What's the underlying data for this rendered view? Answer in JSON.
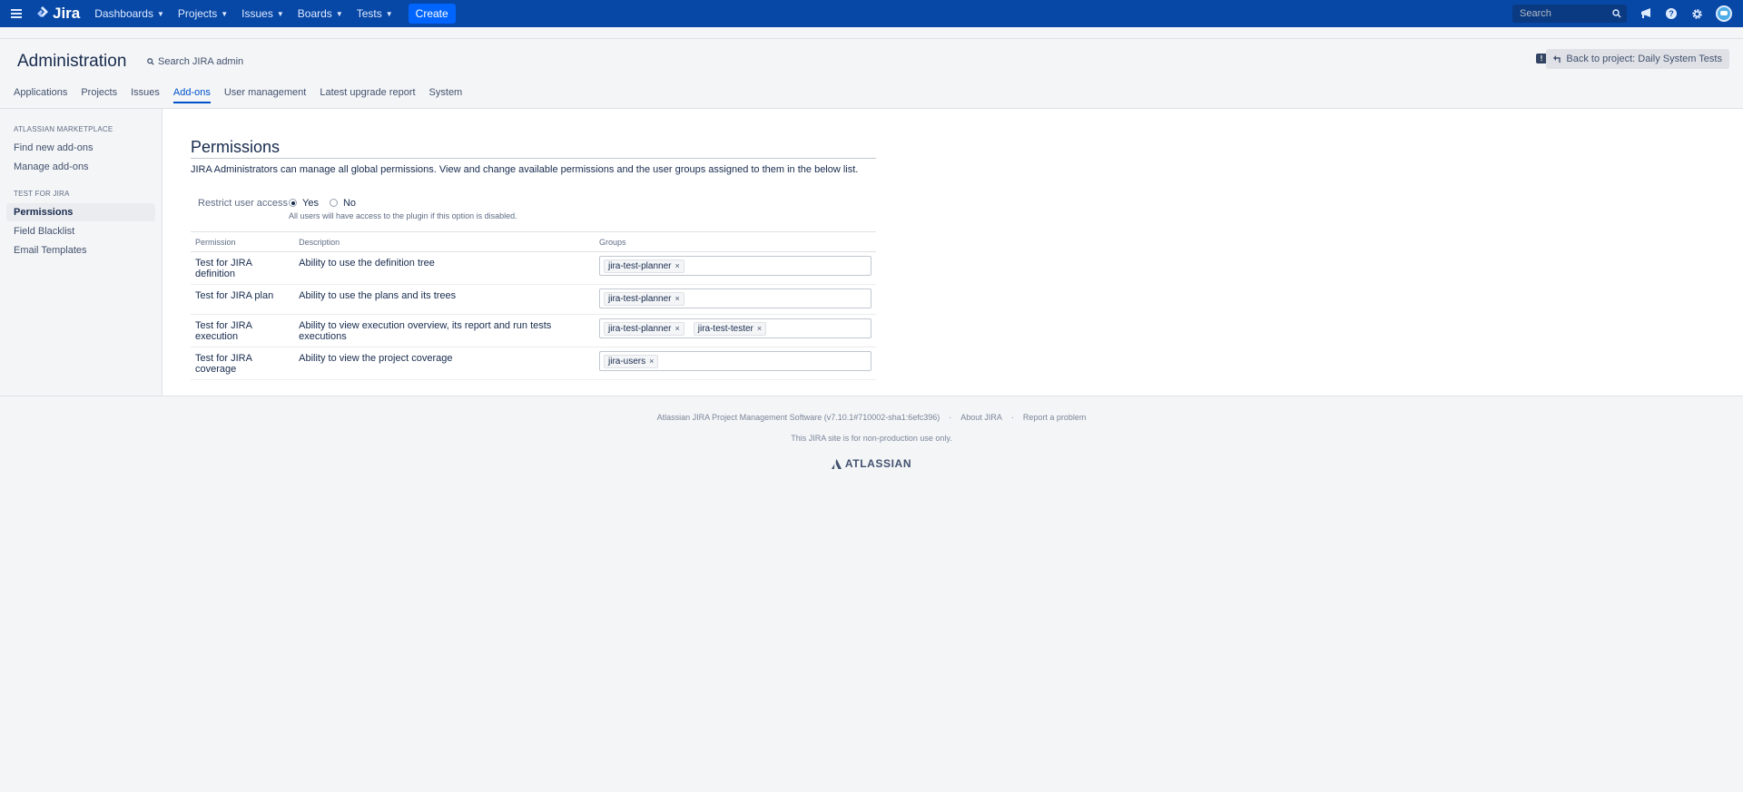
{
  "topnav": {
    "logo_text": "Jira",
    "menus": [
      {
        "label": "Dashboards"
      },
      {
        "label": "Projects"
      },
      {
        "label": "Issues"
      },
      {
        "label": "Boards"
      },
      {
        "label": "Tests"
      }
    ],
    "create_label": "Create",
    "search_placeholder": "Search",
    "icons": [
      "hamburger-icon",
      "jira-logo-icon",
      "search-icon",
      "notifications-icon",
      "help-icon",
      "settings-gear-icon",
      "avatar"
    ],
    "colors": {
      "bar": "#0747a6",
      "create": "#0065ff"
    }
  },
  "admin": {
    "title": "Administration",
    "search_label": "Search JIRA admin",
    "feedback_glyph": "!",
    "back_label": "Back to project: Daily System Tests"
  },
  "tabs": [
    {
      "label": "Applications"
    },
    {
      "label": "Projects"
    },
    {
      "label": "Issues"
    },
    {
      "label": "Add-ons",
      "active": true
    },
    {
      "label": "User management"
    },
    {
      "label": "Latest upgrade report"
    },
    {
      "label": "System"
    }
  ],
  "sidebar": {
    "sections": [
      {
        "heading": "ATLASSIAN MARKETPLACE",
        "items": [
          "Find new add-ons",
          "Manage add-ons"
        ]
      },
      {
        "heading": "TEST FOR JIRA",
        "items": [
          "Permissions",
          "Field Blacklist",
          "Email Templates"
        ],
        "selected": "Permissions"
      }
    ]
  },
  "panel": {
    "title": "Permissions",
    "description": "JIRA Administrators can manage all global permissions. View and change available permissions and the user groups assigned to them in the below list.",
    "restrict": {
      "label": "Restrict user access",
      "options": [
        "Yes",
        "No"
      ],
      "selected": "Yes",
      "hint": "All users will have access to the plugin if this option is disabled."
    },
    "table": {
      "headers": [
        "Permission",
        "Description",
        "Groups"
      ],
      "rows": [
        {
          "permission": "Test for JIRA definition",
          "description": "Ability to use the definition tree",
          "groups": [
            "jira-test-planner"
          ]
        },
        {
          "permission": "Test for JIRA plan",
          "description": "Ability to use the plans and its trees",
          "groups": [
            "jira-test-planner"
          ]
        },
        {
          "permission": "Test for JIRA execution",
          "description": "Ability to view execution overview, its report and run tests executions",
          "groups": [
            "jira-test-planner",
            "jira-test-tester"
          ]
        },
        {
          "permission": "Test for JIRA coverage",
          "description": "Ability to view the project coverage",
          "groups": [
            "jira-users"
          ]
        }
      ]
    },
    "chip_remove_glyph": "×"
  },
  "footer": {
    "version": "Atlassian JIRA Project Management Software (v7.10.1#710002-sha1:6efc396)",
    "separator": "·",
    "about": "About JIRA",
    "report": "Report a problem",
    "notice": "This JIRA site is for non-production use only.",
    "brand": "ATLASSIAN"
  }
}
